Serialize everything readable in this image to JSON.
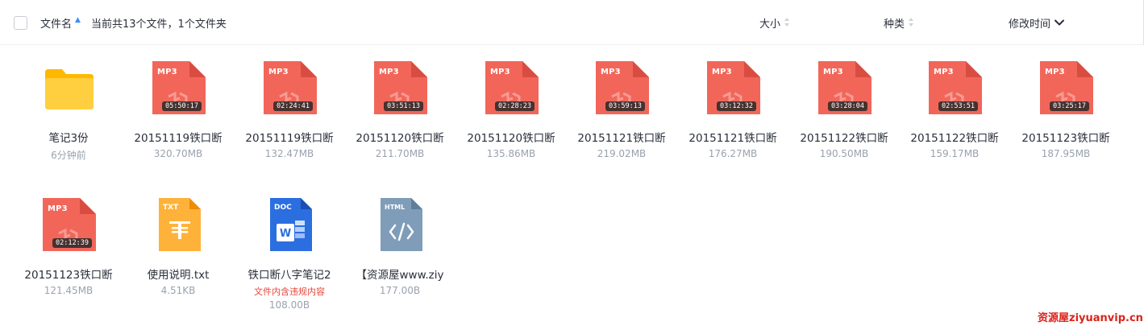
{
  "header": {
    "name_label": "文件名",
    "count_text": "当前共13个文件，1个文件夹",
    "size_label": "大小",
    "type_label": "种类",
    "time_label": "修改时间"
  },
  "colors": {
    "mp3_red": "#f2665a",
    "folder_yellow": "#ffc933",
    "txt_orange": "#ffac33",
    "doc_blue": "#2b6ee0",
    "html_gray": "#7f9db8",
    "warning_red": "#e8463a",
    "watermark_red": "#d9241b"
  },
  "items": [
    {
      "type": "folder",
      "icon": "folder-icon",
      "name": "笔记3份",
      "meta": "6分钟前"
    },
    {
      "type": "mp3",
      "icon": "mp3-file-icon",
      "badge": "MP3",
      "duration": "05:50:17",
      "name": "20151119铁口断",
      "meta": "320.70MB"
    },
    {
      "type": "mp3",
      "icon": "mp3-file-icon",
      "badge": "MP3",
      "duration": "02:24:41",
      "name": "20151119铁口断",
      "meta": "132.47MB"
    },
    {
      "type": "mp3",
      "icon": "mp3-file-icon",
      "badge": "MP3",
      "duration": "03:51:13",
      "name": "20151120铁口断",
      "meta": "211.70MB"
    },
    {
      "type": "mp3",
      "icon": "mp3-file-icon",
      "badge": "MP3",
      "duration": "02:28:23",
      "name": "20151120铁口断",
      "meta": "135.86MB"
    },
    {
      "type": "mp3",
      "icon": "mp3-file-icon",
      "badge": "MP3",
      "duration": "03:59:13",
      "name": "20151121铁口断",
      "meta": "219.02MB"
    },
    {
      "type": "mp3",
      "icon": "mp3-file-icon",
      "badge": "MP3",
      "duration": "03:12:32",
      "name": "20151121铁口断",
      "meta": "176.27MB"
    },
    {
      "type": "mp3",
      "icon": "mp3-file-icon",
      "badge": "MP3",
      "duration": "03:28:04",
      "name": "20151122铁口断",
      "meta": "190.50MB"
    },
    {
      "type": "mp3",
      "icon": "mp3-file-icon",
      "badge": "MP3",
      "duration": "02:53:51",
      "name": "20151122铁口断",
      "meta": "159.17MB"
    },
    {
      "type": "mp3",
      "icon": "mp3-file-icon",
      "badge": "MP3",
      "duration": "03:25:17",
      "name": "20151123铁口断",
      "meta": "187.95MB"
    },
    {
      "type": "mp3",
      "icon": "mp3-file-icon",
      "badge": "MP3",
      "duration": "02:12:39",
      "name": "20151123铁口断",
      "meta": "121.45MB"
    },
    {
      "type": "txt",
      "icon": "txt-file-icon",
      "badge": "TXT",
      "name": "使用说明.txt",
      "meta": "4.51KB"
    },
    {
      "type": "doc",
      "icon": "doc-file-icon",
      "badge": "DOC",
      "name": "铁口断八字笔记2",
      "warning": "文件内含违规内容",
      "meta": "108.00B"
    },
    {
      "type": "html",
      "icon": "html-file-icon",
      "badge": "HTML",
      "name": "【资源屋www.ziy",
      "meta": "177.00B"
    }
  ],
  "watermark": "资源屋ziyuanvip.cn"
}
